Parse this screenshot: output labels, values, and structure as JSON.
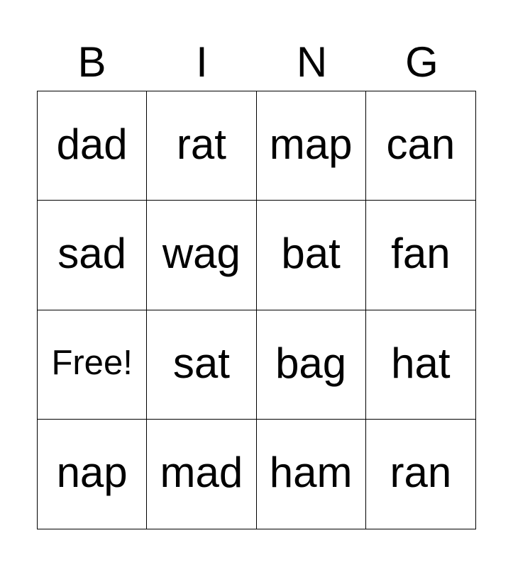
{
  "header": [
    "B",
    "I",
    "N",
    "G"
  ],
  "cells": [
    [
      "dad",
      "rat",
      "map",
      "can"
    ],
    [
      "sad",
      "wag",
      "bat",
      "fan"
    ],
    [
      "Free!",
      "sat",
      "bag",
      "hat"
    ],
    [
      "nap",
      "mad",
      "ham",
      "ran"
    ]
  ]
}
